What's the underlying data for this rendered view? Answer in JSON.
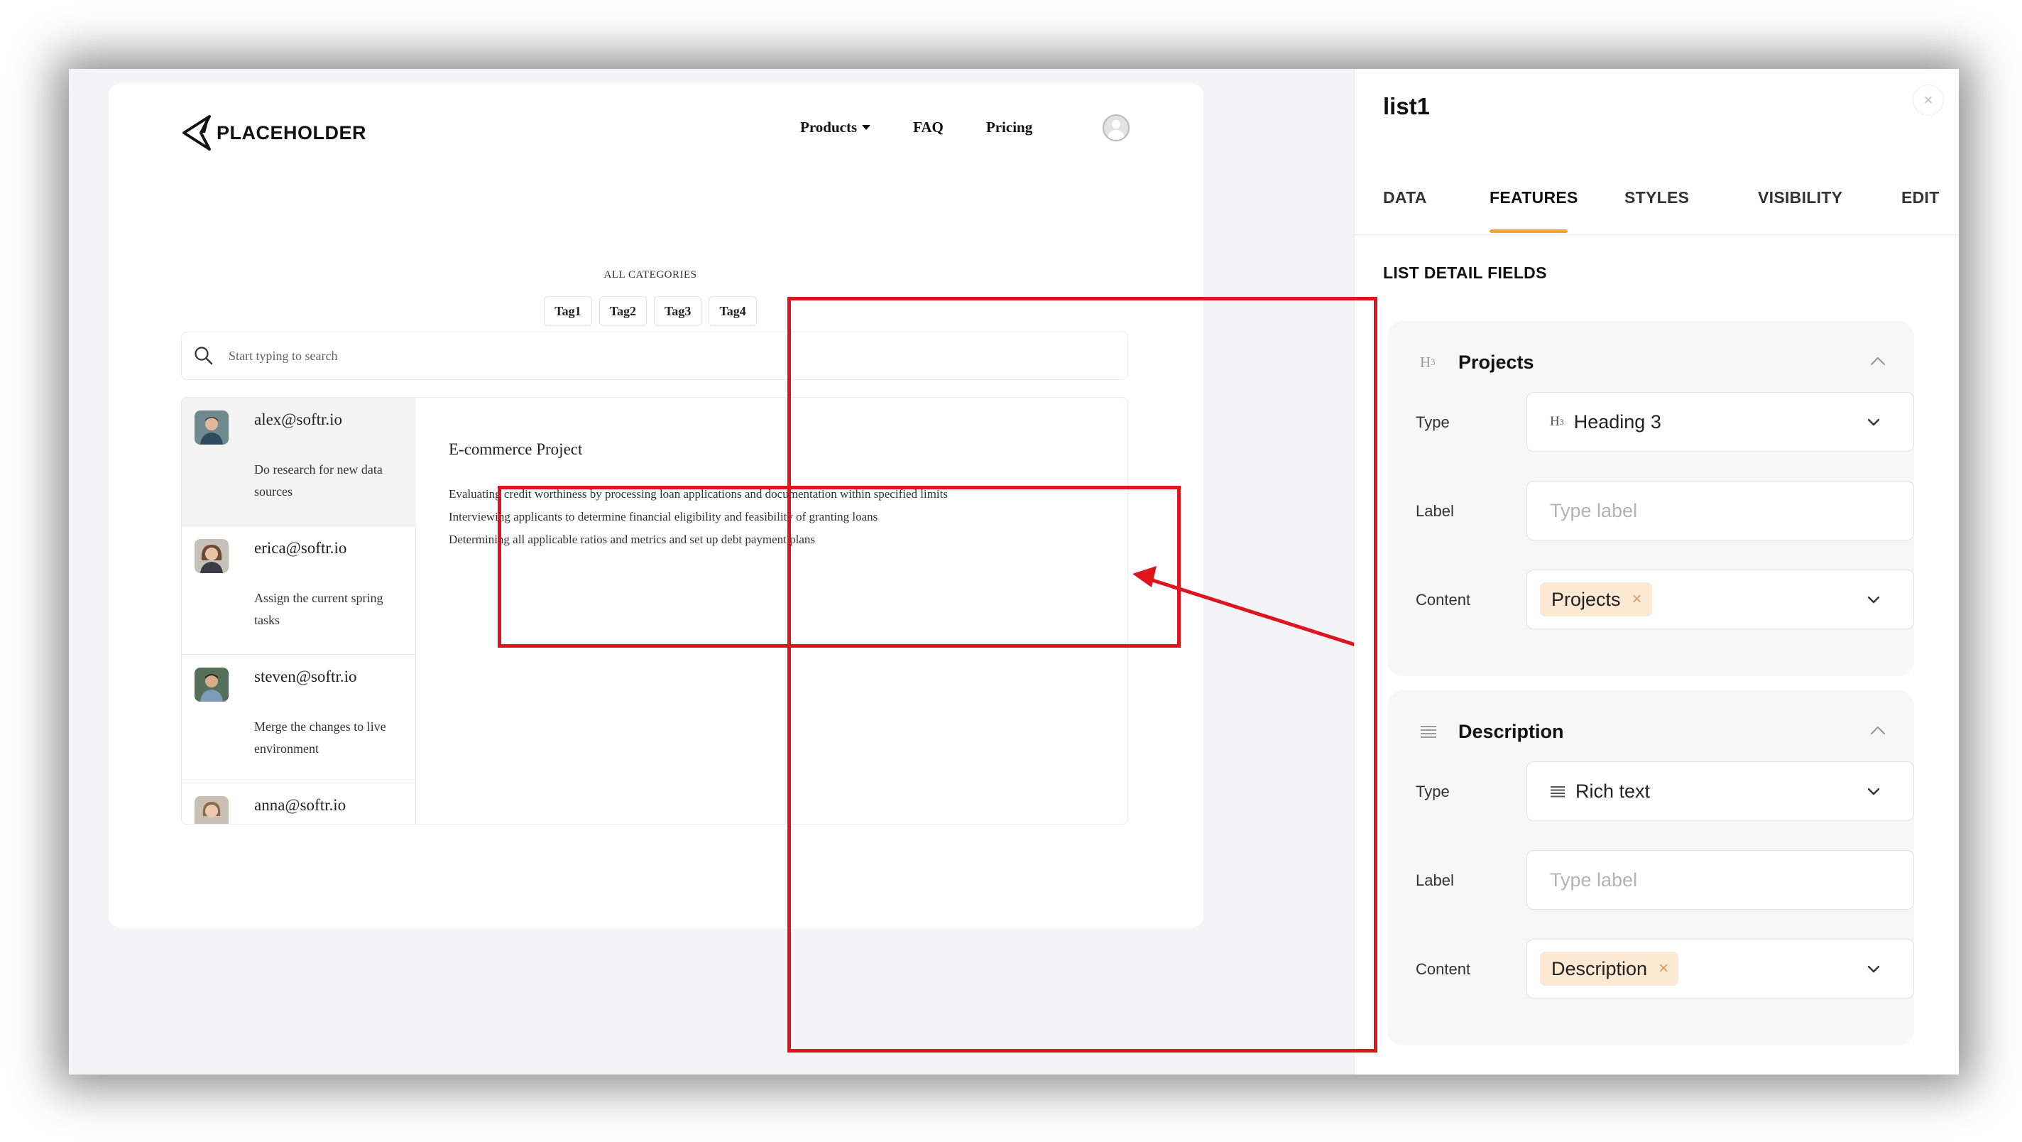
{
  "preview": {
    "logo_text": "PLACEHOLDER",
    "nav": [
      "Products",
      "FAQ",
      "Pricing"
    ],
    "categories_label": "ALL CATEGORIES",
    "tags": [
      "Tag1",
      "Tag2",
      "Tag3",
      "Tag4"
    ],
    "search_placeholder": "Start typing to search",
    "list": [
      {
        "email": "alex@softr.io",
        "desc": "Do research for new data sources"
      },
      {
        "email": "erica@softr.io",
        "desc": "Assign the current spring tasks"
      },
      {
        "email": "steven@softr.io",
        "desc": "Merge the changes to live environment"
      },
      {
        "email": "anna@softr.io",
        "desc": ""
      }
    ],
    "detail": {
      "title": "E-commerce Project",
      "lines": [
        "Evaluating credit worthiness by processing loan applications and documentation within specified limits",
        "Interviewing applicants to determine financial eligibility and feasibility of granting loans",
        "Determining all applicable ratios and metrics and set up debt payment plans"
      ]
    }
  },
  "panel": {
    "title": "list1",
    "close_glyph": "×",
    "tabs": [
      "DATA",
      "FEATURES",
      "STYLES",
      "VISIBILITY",
      "EDIT"
    ],
    "active_tab": "FEATURES",
    "section_heading": "LIST DETAIL FIELDS",
    "fields": [
      {
        "name": "Projects",
        "head_icon": "heading-3-icon",
        "type_label": "Type",
        "type_value": "Heading 3",
        "label_label": "Label",
        "label_placeholder": "Type label",
        "content_label": "Content",
        "content_chip": "Projects"
      },
      {
        "name": "Description",
        "head_icon": "rich-text-icon",
        "type_label": "Type",
        "type_value": "Rich text",
        "label_label": "Label",
        "label_placeholder": "Type label",
        "content_label": "Content",
        "content_chip": "Description"
      }
    ]
  },
  "colors": {
    "accent_underline": "#f2a33c",
    "chip_bg": "#fbe9d3",
    "highlight_red": "#e0141c"
  }
}
